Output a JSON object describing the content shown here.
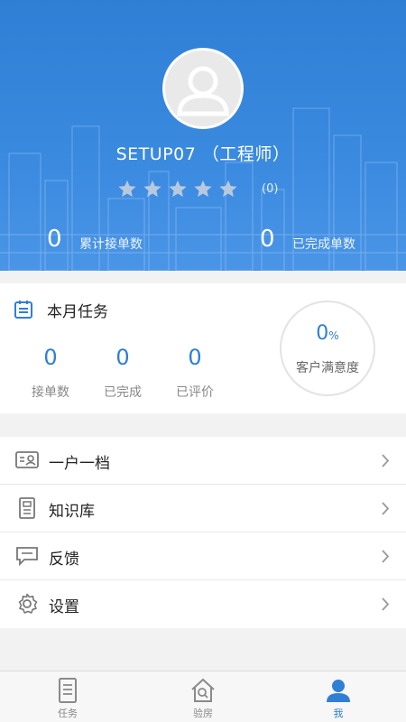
{
  "profile": {
    "name": "SETUP07 （工程师）",
    "rating_count": "(0)",
    "stars": 5
  },
  "stats": {
    "total_orders_value": "0",
    "total_orders_label": "累计接单数",
    "completed_value": "0",
    "completed_label": "已完成单数"
  },
  "month": {
    "title": "本月任务",
    "metrics": [
      {
        "value": "0",
        "label": "接单数"
      },
      {
        "value": "0",
        "label": "已完成"
      },
      {
        "value": "0",
        "label": "已评价"
      }
    ],
    "satisfaction": {
      "value": "0",
      "unit": "%",
      "label": "客户满意度"
    }
  },
  "menu": {
    "items": [
      {
        "label": "一户一档",
        "icon": "id-card-icon"
      },
      {
        "label": "知识库",
        "icon": "document-icon"
      },
      {
        "label": "反馈",
        "icon": "feedback-icon"
      },
      {
        "label": "设置",
        "icon": "gear-icon"
      }
    ]
  },
  "tabbar": {
    "items": [
      {
        "label": "任务",
        "icon": "task-list-icon"
      },
      {
        "label": "验房",
        "icon": "house-inspect-icon"
      },
      {
        "label": "我",
        "icon": "user-icon"
      }
    ],
    "active": "我"
  },
  "colors": {
    "accent": "#2f7fd6",
    "header_bg": "#3a8ae0",
    "star_inactive": "#b9c9dd"
  }
}
